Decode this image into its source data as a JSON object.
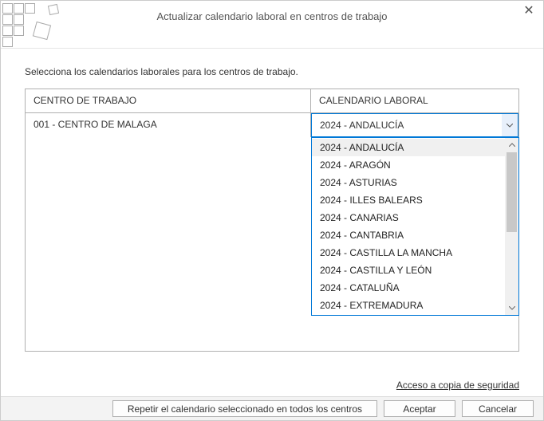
{
  "window": {
    "title": "Actualizar calendario laboral en centros de trabajo"
  },
  "instruction": "Selecciona los calendarios laborales para los centros de trabajo.",
  "table": {
    "headers": {
      "col1": "CENTRO DE TRABAJO",
      "col2": "CALENDARIO LABORAL"
    },
    "rows": [
      {
        "centro": "001 - CENTRO DE MALAGA",
        "calendario": "2024 - ANDALUCÍA"
      }
    ]
  },
  "dropdown": {
    "options": [
      "2024 - ANDALUCÍA",
      "2024 - ARAGÓN",
      "2024 - ASTURIAS",
      "2024 - ILLES BALEARS",
      "2024 - CANARIAS",
      "2024 - CANTABRIA",
      "2024 - CASTILLA LA MANCHA",
      "2024 - CASTILLA Y LEÓN",
      "2024 - CATALUÑA",
      "2024 - EXTREMADURA"
    ],
    "selected_index": 0
  },
  "links": {
    "backup": "Acceso a copia de seguridad"
  },
  "footer": {
    "repeat": "Repetir el calendario seleccionado en todos los centros",
    "accept": "Aceptar",
    "cancel": "Cancelar"
  }
}
